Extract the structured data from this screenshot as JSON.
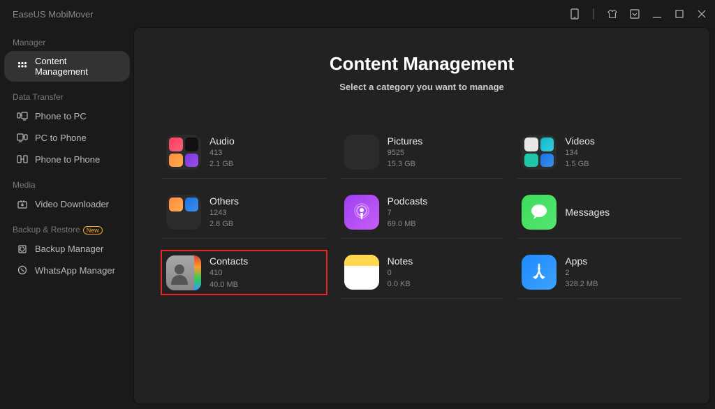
{
  "app_title": "EaseUS MobiMover",
  "titlebar_icons": [
    "phone-icon",
    "shirt-icon",
    "dropdown-icon",
    "minimize-icon",
    "maximize-icon",
    "close-icon"
  ],
  "sidebar": {
    "sections": [
      {
        "title": "Manager",
        "items": [
          {
            "key": "content-management",
            "label": "Content Management",
            "icon": "grid-icon",
            "active": true
          }
        ]
      },
      {
        "title": "Data Transfer",
        "items": [
          {
            "key": "phone-to-pc",
            "label": "Phone to PC",
            "icon": "phone-to-pc-icon"
          },
          {
            "key": "pc-to-phone",
            "label": "PC to Phone",
            "icon": "pc-to-phone-icon"
          },
          {
            "key": "phone-to-phone",
            "label": "Phone to Phone",
            "icon": "phone-to-phone-icon"
          }
        ]
      },
      {
        "title": "Media",
        "items": [
          {
            "key": "video-downloader",
            "label": "Video Downloader",
            "icon": "download-icon"
          }
        ]
      },
      {
        "title": "Backup & Restore",
        "badge": "New",
        "items": [
          {
            "key": "backup-manager",
            "label": "Backup Manager",
            "icon": "backup-icon"
          },
          {
            "key": "whatsapp-manager",
            "label": "WhatsApp Manager",
            "icon": "whatsapp-icon"
          }
        ]
      }
    ]
  },
  "page": {
    "title": "Content Management",
    "subtitle": "Select a category you want to manage"
  },
  "categories": [
    {
      "key": "audio",
      "title": "Audio",
      "count": "413",
      "size": "2.1 GB",
      "iconStyle": "quad-audio"
    },
    {
      "key": "pictures",
      "title": "Pictures",
      "count": "9525",
      "size": "15.3 GB",
      "iconStyle": "quad-pictures"
    },
    {
      "key": "videos",
      "title": "Videos",
      "count": "134",
      "size": "1.5 GB",
      "iconStyle": "quad-videos"
    },
    {
      "key": "others",
      "title": "Others",
      "count": "1243",
      "size": "2.8 GB",
      "iconStyle": "quad-others"
    },
    {
      "key": "podcasts",
      "title": "Podcasts",
      "count": "7",
      "size": "69.0 MB",
      "iconStyle": "podcast"
    },
    {
      "key": "messages",
      "title": "Messages",
      "count": "",
      "size": "",
      "iconStyle": "message"
    },
    {
      "key": "contacts",
      "title": "Contacts",
      "count": "410",
      "size": "40.0 MB",
      "iconStyle": "contacts",
      "highlight": true
    },
    {
      "key": "notes",
      "title": "Notes",
      "count": "0",
      "size": "0.0 KB",
      "iconStyle": "notes"
    },
    {
      "key": "apps",
      "title": "Apps",
      "count": "2",
      "size": "328.2 MB",
      "iconStyle": "apps"
    }
  ]
}
